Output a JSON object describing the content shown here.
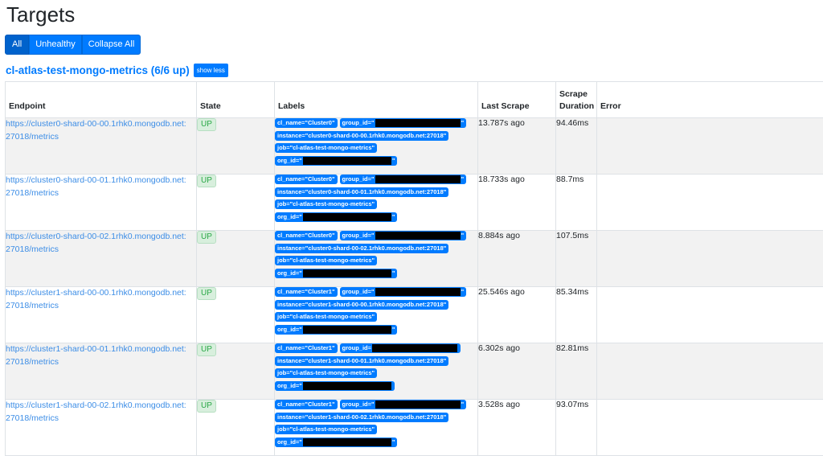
{
  "page": {
    "title": "Targets"
  },
  "filters": {
    "all": "All",
    "unhealthy": "Unhealthy",
    "collapse_all": "Collapse All"
  },
  "job": {
    "title": "cl-atlas-test-mongo-metrics (6/6 up)",
    "show_less": "show less"
  },
  "table": {
    "headers": {
      "endpoint": "Endpoint",
      "state": "State",
      "labels": "Labels",
      "last_scrape": "Last Scrape",
      "scrape_duration": "Scrape Duration",
      "error": "Error"
    },
    "rows": [
      {
        "endpoint_line1": "https://cluster0-shard-00-00.1rhk0.mongodb.net:",
        "endpoint_line2": "27018/metrics",
        "state": "UP",
        "cl_name": "cl_name=\"Cluster0\"",
        "group_id": "group_id=\"",
        "instance": "instance=\"cluster0-shard-00-00.1rhk0.mongodb.net:27018\"",
        "job": "job=\"cl-atlas-test-mongo-metrics\"",
        "org_id": "org_id=\"",
        "quote": "\"",
        "last_scrape": "13.787s ago",
        "duration": "94.46ms",
        "error": ""
      },
      {
        "endpoint_line1": "https://cluster0-shard-00-01.1rhk0.mongodb.net:",
        "endpoint_line2": "27018/metrics",
        "state": "UP",
        "cl_name": "cl_name=\"Cluster0\"",
        "group_id": "group_id=\"",
        "instance": "instance=\"cluster0-shard-00-01.1rhk0.mongodb.net:27018\"",
        "job": "job=\"cl-atlas-test-mongo-metrics\"",
        "org_id": "org_id=\"",
        "quote": "\"",
        "last_scrape": "18.733s ago",
        "duration": "88.7ms",
        "error": ""
      },
      {
        "endpoint_line1": "https://cluster0-shard-00-02.1rhk0.mongodb.net:",
        "endpoint_line2": "27018/metrics",
        "state": "UP",
        "cl_name": "cl_name=\"Cluster0\"",
        "group_id": "group_id=\"",
        "instance": "instance=\"cluster0-shard-00-02.1rhk0.mongodb.net:27018\"",
        "job": "job=\"cl-atlas-test-mongo-metrics\"",
        "org_id": "org_id=\"",
        "quote": "\"",
        "last_scrape": "8.884s ago",
        "duration": "107.5ms",
        "error": ""
      },
      {
        "endpoint_line1": "https://cluster1-shard-00-00.1rhk0.mongodb.net:",
        "endpoint_line2": "27018/metrics",
        "state": "UP",
        "cl_name": "cl_name=\"Cluster1\"",
        "group_id": "group_id=\"",
        "instance": "instance=\"cluster1-shard-00-00.1rhk0.mongodb.net:27018\"",
        "job": "job=\"cl-atlas-test-mongo-metrics\"",
        "org_id": "org_id=\"",
        "quote": "\"",
        "last_scrape": "25.546s ago",
        "duration": "85.34ms",
        "error": ""
      },
      {
        "endpoint_line1": "https://cluster1-shard-00-01.1rhk0.mongodb.net:",
        "endpoint_line2": "27018/metrics",
        "state": "UP",
        "cl_name": "cl_name=\"Cluster1\"",
        "group_id": "group_id=",
        "instance": "instance=\"cluster1-shard-00-01.1rhk0.mongodb.net:27018\"",
        "job": "job=\"cl-atlas-test-mongo-metrics\"",
        "org_id": "org_id=\"",
        "quote": "",
        "last_scrape": "6.302s ago",
        "duration": "82.81ms",
        "error": ""
      },
      {
        "endpoint_line1": "https://cluster1-shard-00-02.1rhk0.mongodb.net:",
        "endpoint_line2": "27018/metrics",
        "state": "UP",
        "cl_name": "cl_name=\"Cluster1\"",
        "group_id": "group_id=\"",
        "instance": "instance=\"cluster1-shard-00-02.1rhk0.mongodb.net:27018\"",
        "job": "job=\"cl-atlas-test-mongo-metrics\"",
        "org_id": "org_id=\"",
        "quote": "\"",
        "last_scrape": "3.528s ago",
        "duration": "93.07ms",
        "error": ""
      }
    ]
  },
  "colors": {
    "primary": "#007bff",
    "up_green": "#28a745",
    "link": "#3c8de6"
  }
}
